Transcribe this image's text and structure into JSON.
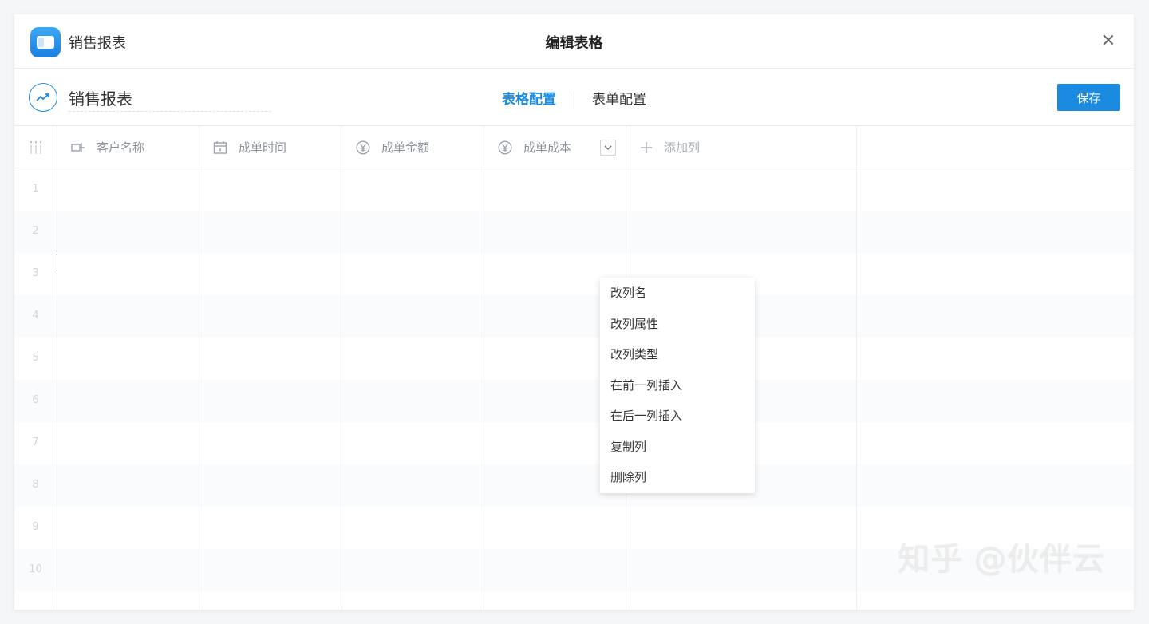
{
  "app": {
    "name": "销售报表"
  },
  "dialog": {
    "title": "编辑表格"
  },
  "toolbar": {
    "report_name": "销售报表",
    "tabs": [
      {
        "label": "表格配置",
        "active": true
      },
      {
        "label": "表单配置",
        "active": false
      }
    ],
    "save_label": "保存"
  },
  "columns": [
    {
      "label": "客户名称",
      "icon": "text-field-icon"
    },
    {
      "label": "成单时间",
      "icon": "calendar-icon"
    },
    {
      "label": "成单金额",
      "icon": "yen-icon"
    },
    {
      "label": "成单成本",
      "icon": "yen-icon"
    }
  ],
  "add_column_label": "添加列",
  "rows": [
    "1",
    "2",
    "3",
    "4",
    "5",
    "6",
    "7",
    "8",
    "9",
    "10"
  ],
  "column_menu": {
    "items": [
      "改列名",
      "改列属性",
      "改列类型",
      "在前一列插入",
      "在后一列插入",
      "复制列",
      "删除列"
    ]
  },
  "watermark": "知乎 @伙伴云",
  "colors": {
    "accent": "#1a8be0"
  }
}
